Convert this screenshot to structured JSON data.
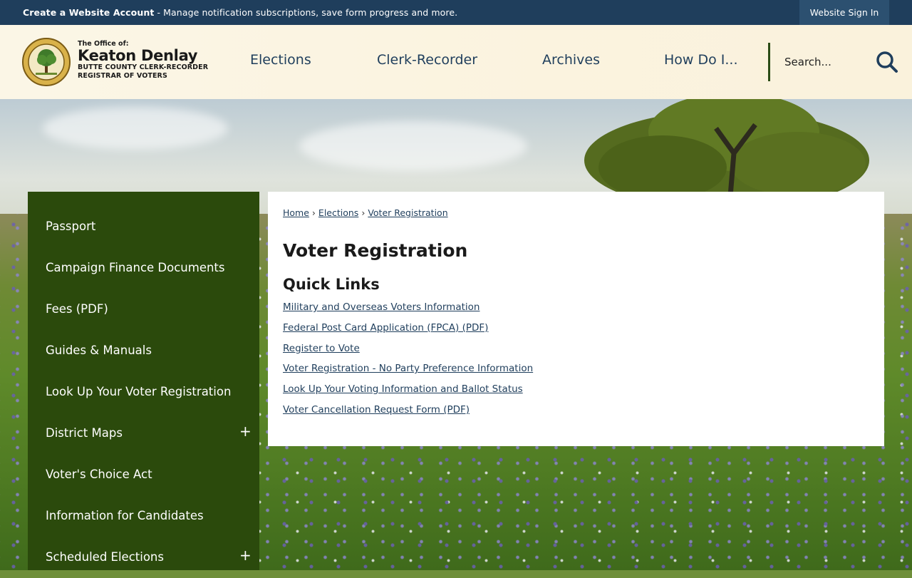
{
  "topbar": {
    "account_link": "Create a Website Account",
    "account_desc": " - Manage notification subscriptions, save form progress and more.",
    "signin_label": "Website Sign In"
  },
  "header": {
    "brand_pre": "The Office of:",
    "brand_name": "Keaton Denlay",
    "brand_line1": "BUTTE COUNTY CLERK-RECORDER",
    "brand_line2": "REGISTRAR OF VOTERS"
  },
  "nav": {
    "items": [
      {
        "label": "Elections"
      },
      {
        "label": "Clerk-Recorder"
      },
      {
        "label": "Archives"
      },
      {
        "label": "How Do I..."
      }
    ]
  },
  "search": {
    "placeholder": "Search..."
  },
  "sidebar": {
    "items": [
      {
        "label": "Passport",
        "expandable": false
      },
      {
        "label": "Campaign Finance Documents",
        "expandable": false
      },
      {
        "label": "Fees (PDF)",
        "expandable": false
      },
      {
        "label": "Guides & Manuals",
        "expandable": false
      },
      {
        "label": "Look Up Your Voter Registration",
        "expandable": false
      },
      {
        "label": "District Maps",
        "expandable": true
      },
      {
        "label": "Voter's Choice Act",
        "expandable": false
      },
      {
        "label": "Information for Candidates",
        "expandable": false
      },
      {
        "label": "Scheduled Elections",
        "expandable": true
      }
    ],
    "expand_symbol": "+"
  },
  "breadcrumb": {
    "items": [
      "Home",
      "Elections",
      "Voter Registration"
    ],
    "separator": "›"
  },
  "main": {
    "title": "Voter Registration",
    "section_title": "Quick Links",
    "links": [
      "Military and Overseas Voters Information",
      "Federal Post Card Application (FPCA) (PDF)",
      "Register to Vote",
      "Voter Registration - No Party Preference Information",
      "Look Up Your Voting Information and Ballot Status",
      "Voter Cancellation Request Form (PDF)"
    ]
  },
  "colors": {
    "topbar": "#1f3e5c",
    "sidebar": "#2b4a0c",
    "link": "#1f3e5c",
    "accent": "#2a4c16"
  }
}
